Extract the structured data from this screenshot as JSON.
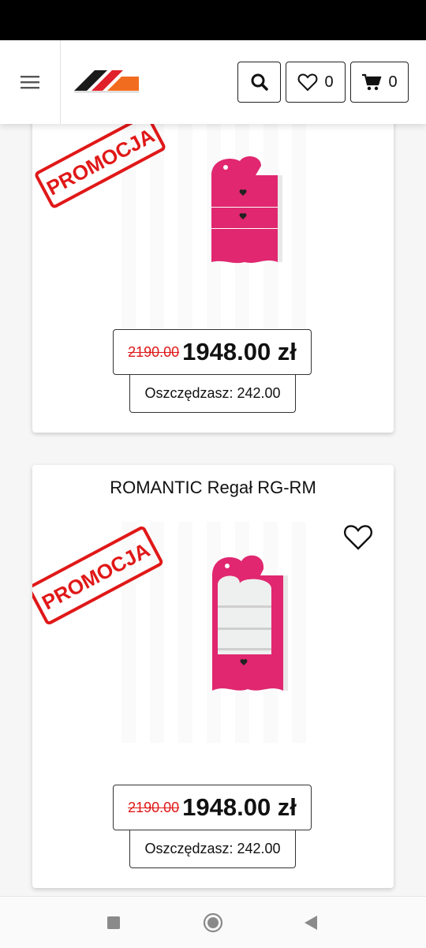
{
  "header": {
    "wishlist_count": "0",
    "cart_count": "0",
    "icons": {
      "menu": "hamburger-icon",
      "search": "search-icon",
      "wishlist": "heart-icon",
      "cart": "cart-icon"
    }
  },
  "colors": {
    "accent_red": "#e01818",
    "brand_orange": "#f26c1f",
    "product_pink": "#e0276f"
  },
  "products": [
    {
      "title": "",
      "badge": "PROMOCJA",
      "old_price": "2190.00",
      "price": "1948.00 zł",
      "savings": "Oszczędzasz: 242.00"
    },
    {
      "title": "ROMANTIC Regał RG-RM",
      "badge": "PROMOCJA",
      "old_price": "2190.00",
      "price": "1948.00 zł",
      "savings": "Oszczędzasz: 242.00"
    }
  ],
  "system_nav": {
    "icons": [
      "recent-apps-icon",
      "home-icon",
      "back-icon"
    ]
  }
}
